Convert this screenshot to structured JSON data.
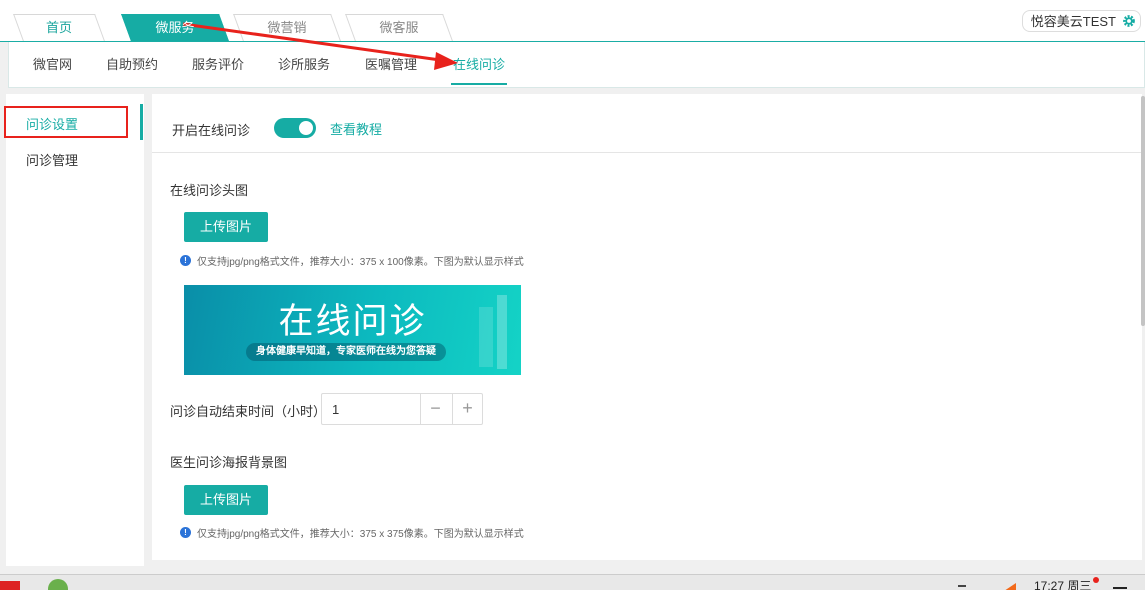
{
  "top_tabs": [
    {
      "label": "首页"
    },
    {
      "label": "微服务"
    },
    {
      "label": "微营销"
    },
    {
      "label": "微客服"
    }
  ],
  "user": {
    "name": "悦容美云TEST",
    "icon": "gear-icon"
  },
  "sub_nav": [
    {
      "label": "微官网"
    },
    {
      "label": "自助预约"
    },
    {
      "label": "服务评价"
    },
    {
      "label": "诊所服务"
    },
    {
      "label": "医嘱管理"
    },
    {
      "label": "在线问诊"
    }
  ],
  "sidebar": {
    "items": [
      {
        "label": "问诊设置"
      },
      {
        "label": "问诊管理"
      }
    ]
  },
  "main": {
    "toggle_label": "开启在线问诊",
    "toggle_on": true,
    "tutorial_link": "查看教程",
    "header_image_label": "在线问诊头图",
    "upload_btn_1": "上传图片",
    "tip_1": "仅支持jpg/png格式文件，推荐大小：375 x 100像素。下图为默认显示样式",
    "banner_title": "在线问诊",
    "banner_subtitle": "身体健康早知道，专家医师在线为您答疑",
    "auto_end_label": "问诊自动结束时间（小时）",
    "auto_end_value": "1",
    "minus": "−",
    "plus": "+",
    "poster_label": "医生问诊海报背景图",
    "upload_btn_2": "上传图片",
    "tip_2": "仅支持jpg/png格式文件，推荐大小：375 x 375像素。下图为默认显示样式"
  },
  "taskbar": {
    "clock": "17:27 周三"
  },
  "colors": {
    "accent": "#16aca4",
    "highlight": "#e8221c"
  }
}
